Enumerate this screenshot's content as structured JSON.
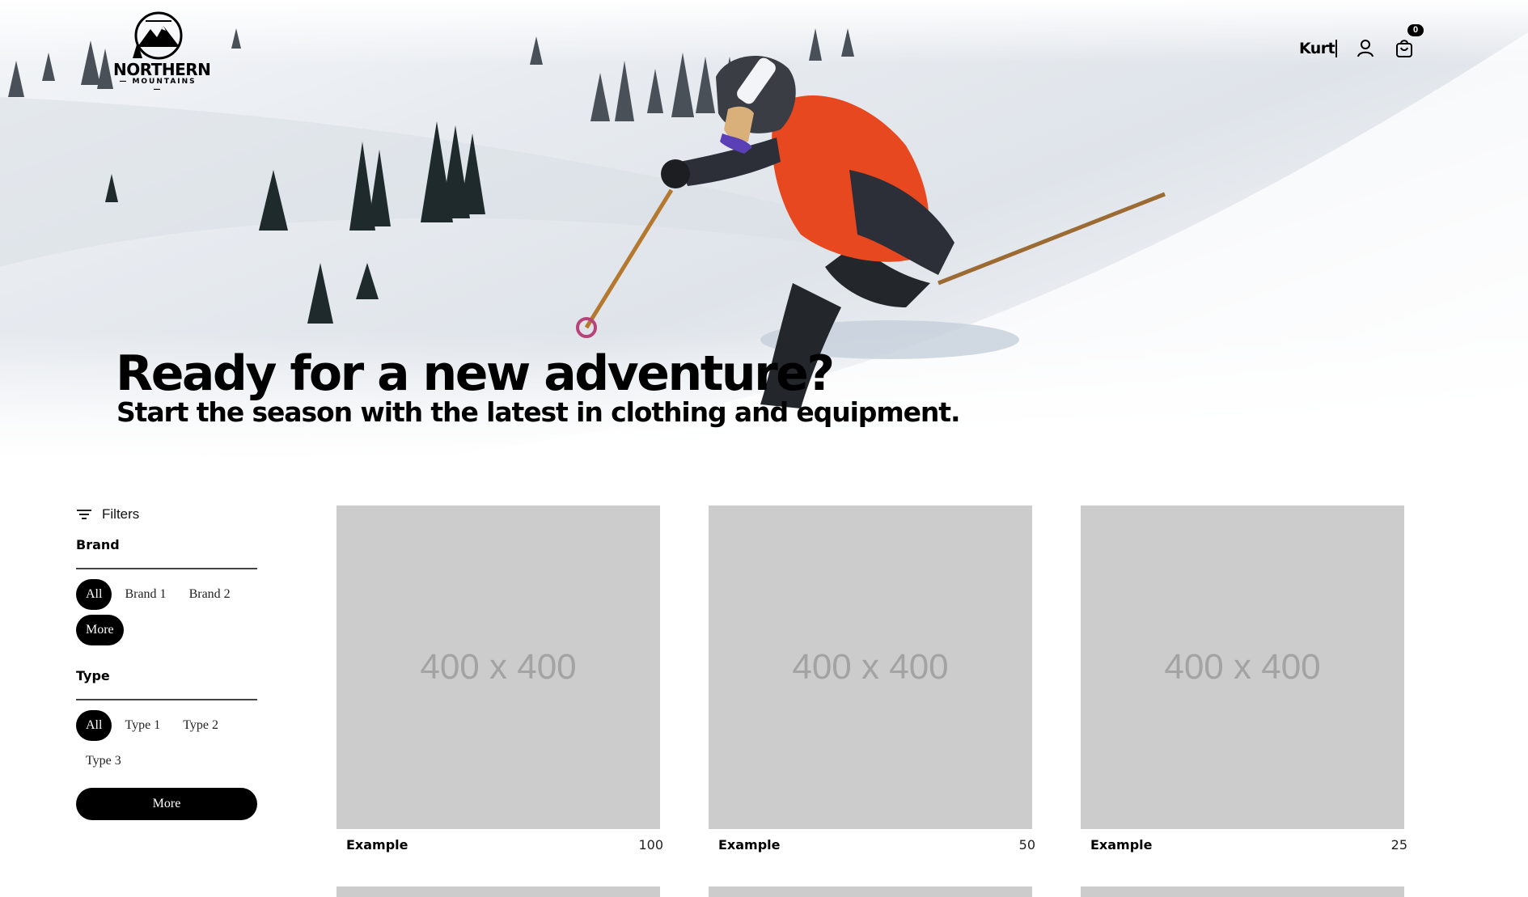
{
  "header": {
    "logo": {
      "brand": "NORTHERN",
      "sub": "— MOUNTAINS —"
    },
    "username": "Kurt",
    "cart_count": "0",
    "icons": [
      "user-icon",
      "cart-icon"
    ]
  },
  "hero": {
    "title": "Ready for a new adventure?",
    "subtitle": "Start the season with the latest in clothing and equipment."
  },
  "sidebar": {
    "filters_label": "Filters",
    "brand": {
      "title": "Brand",
      "options": [
        "All",
        "Brand 1",
        "Brand 2",
        "More"
      ]
    },
    "type": {
      "title": "Type",
      "options": [
        "All",
        "Type 1",
        "Type 2",
        "Type 3"
      ],
      "more_label": "More"
    }
  },
  "products": [
    {
      "image_label": "400 x 400",
      "name": "Example",
      "price": "100"
    },
    {
      "image_label": "400 x 400",
      "name": "Example",
      "price": "50"
    },
    {
      "image_label": "400 x 400",
      "name": "Example",
      "price": "25"
    }
  ],
  "colors": {
    "accent": "#000000",
    "placeholder": "#cccccc",
    "jacket": "#e8481f"
  }
}
